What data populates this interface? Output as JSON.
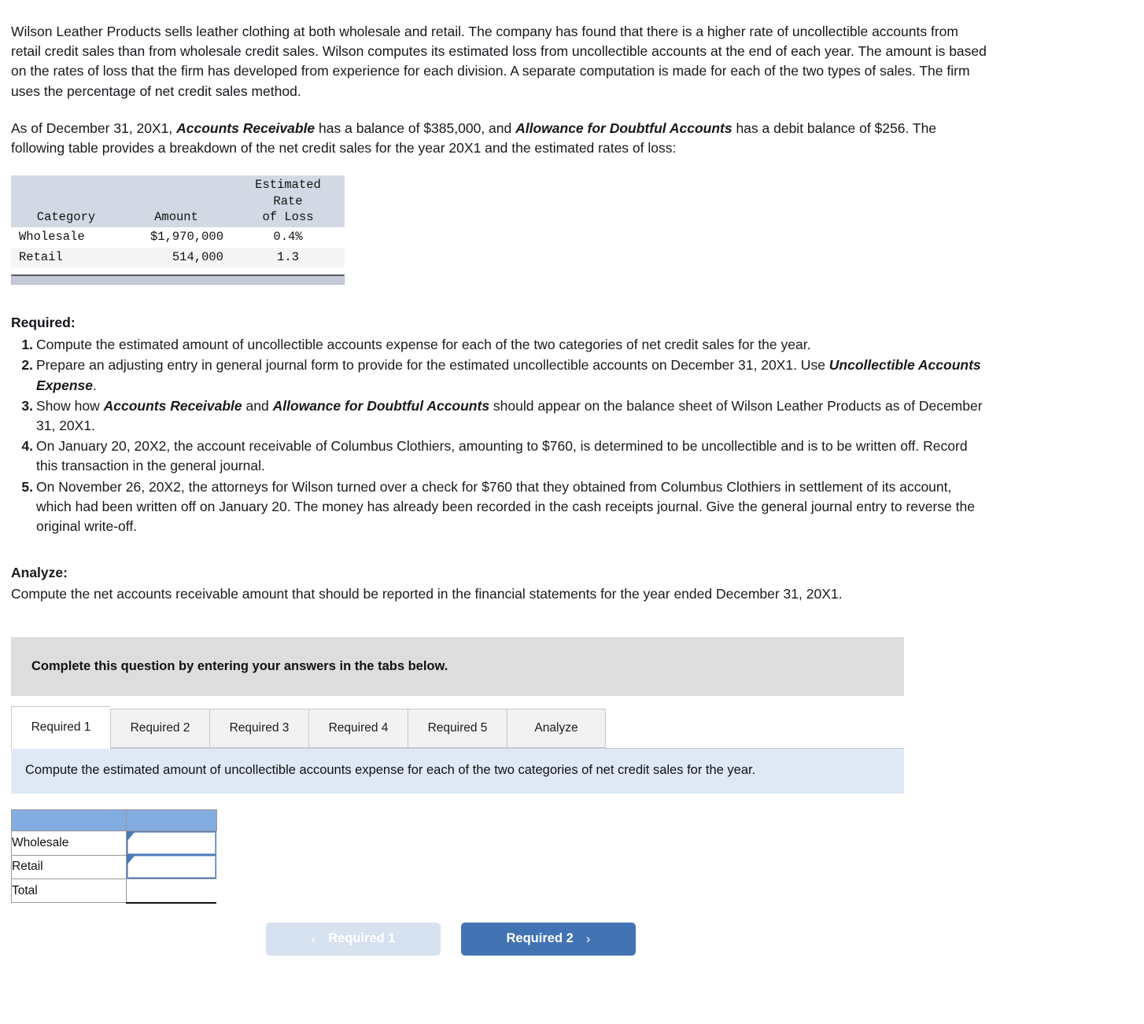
{
  "intro": {
    "paragraph1": "Wilson Leather Products sells leather clothing at both wholesale and retail. The company has found that there is a higher rate of uncollectible accounts from retail credit sales than from wholesale credit sales. Wilson computes its estimated loss from uncollectible accounts at the end of each year. The amount is based on the rates of loss that the firm has developed from experience for each division. A separate computation is made for each of the two types of sales. The firm uses the percentage of net credit sales method.",
    "p2_part1": "As of December 31, 20X1, ",
    "p2_term1": "Accounts Receivable",
    "p2_part2": " has a balance of $385,000, and ",
    "p2_term2": "Allowance for Doubtful Accounts",
    "p2_part3": " has a debit balance of $256. The following table provides a breakdown of the net credit sales for the year 20X1 and the estimated rates of loss:"
  },
  "data_table": {
    "headers": [
      "Category",
      "Amount",
      "Estimated Rate of Loss"
    ],
    "header_rate_line1": "Estimated Rate",
    "header_rate_line2": "of Loss",
    "rows": [
      {
        "category": "Wholesale",
        "amount": "$1,970,000",
        "rate": "0.4%"
      },
      {
        "category": "Retail",
        "amount": "514,000",
        "rate": "1.3"
      }
    ]
  },
  "required": {
    "heading": "Required:",
    "items": [
      {
        "text": "Compute the estimated amount of uncollectible accounts expense for each of the two categories of net credit sales for the year."
      },
      {
        "pre": "Prepare an adjusting entry in general journal form to provide for the estimated uncollectible accounts on December 31, 20X1. Use ",
        "term": "Uncollectible Accounts Expense",
        "post": "."
      },
      {
        "pre": "Show how ",
        "term": "Accounts Receivable",
        "mid": " and ",
        "term2": "Allowance for Doubtful Accounts",
        "post": " should appear on the balance sheet of Wilson Leather Products as of December 31, 20X1."
      },
      {
        "text": "On January 20, 20X2, the account receivable of Columbus Clothiers, amounting to $760, is determined to be uncollectible and is to be written off. Record this transaction in the general journal."
      },
      {
        "text": "On November 26, 20X2, the attorneys for Wilson turned over a check for $760 that they obtained from Columbus Clothiers in settlement of its account, which had been written off on January 20. The money has already been recorded in the cash receipts journal. Give the general journal entry to reverse the original write-off."
      }
    ]
  },
  "analyze": {
    "heading": "Analyze:",
    "text": "Compute the net accounts receivable amount that should be reported in the financial statements for the year ended December 31, 20X1."
  },
  "widget": {
    "banner": "Complete this question by entering your answers in the tabs below.",
    "tabs": [
      {
        "label": "Required 1",
        "active": true
      },
      {
        "label": "Required 2",
        "active": false
      },
      {
        "label": "Required 3",
        "active": false
      },
      {
        "label": "Required 4",
        "active": false
      },
      {
        "label": "Required 5",
        "active": false
      },
      {
        "label": "Analyze",
        "active": false
      }
    ],
    "instruction": "Compute the estimated amount of uncollectible accounts expense for each of the two categories of net credit sales for the year.",
    "answer_table": {
      "header_col1": "",
      "header_col2": "",
      "rows": [
        {
          "label": "Wholesale",
          "value": "",
          "type": "input"
        },
        {
          "label": "Retail",
          "value": "",
          "type": "input"
        },
        {
          "label": "Total",
          "value": "",
          "type": "total"
        }
      ]
    },
    "nav": {
      "prev_label": "Required 1",
      "prev_icon": "chevron-left-icon",
      "next_label": "Required 2",
      "next_icon": "chevron-right-icon"
    }
  },
  "colors": {
    "banner_gray": "#dddddd",
    "instruction_blue": "#dfe9f6",
    "table_header_blue": "#83ace0",
    "data_header_gray": "#d3d9e4",
    "next_button_blue": "#4273b3",
    "prev_button_blue": "#d7e2f0",
    "input_border_blue": "#4b79b8"
  }
}
